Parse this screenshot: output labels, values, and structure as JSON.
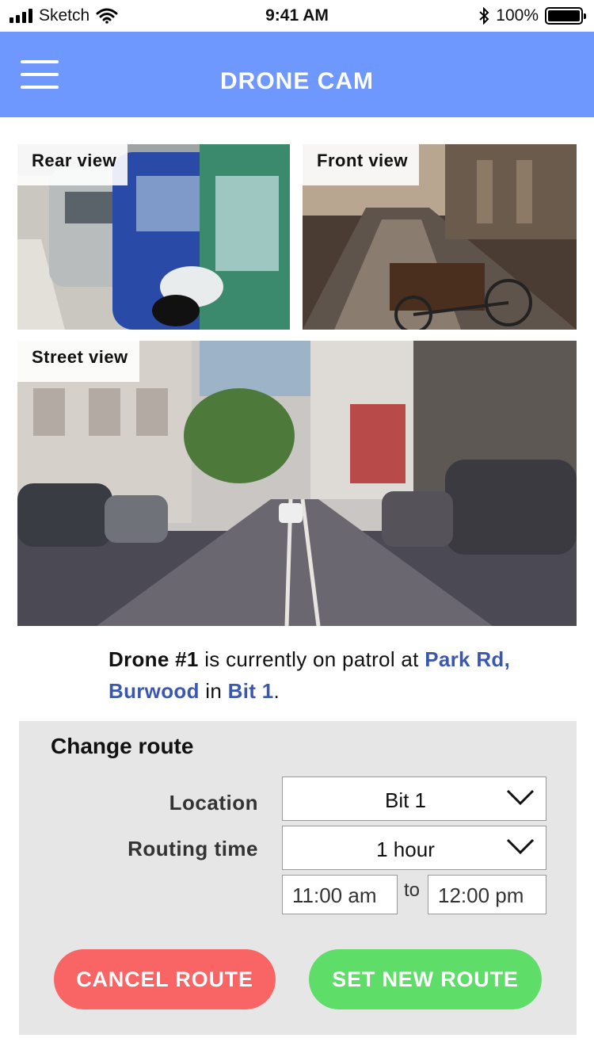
{
  "status_bar": {
    "carrier": "Sketch",
    "time": "9:41 AM",
    "battery": "100%"
  },
  "header": {
    "title": "DRONE CAM"
  },
  "cameras": {
    "rear": {
      "label": "Rear view"
    },
    "front": {
      "label": "Front view"
    },
    "street": {
      "label": "Street view"
    }
  },
  "status": {
    "drone": "Drone #1",
    "text1": " is currently on patrol at ",
    "location": "Park Rd, Burwood",
    "text2": " in ",
    "area": "Bit 1",
    "text3": "."
  },
  "route": {
    "title": "Change route",
    "location_label": "Location",
    "location_value": "Bit 1",
    "routing_label": "Routing time",
    "routing_value": "1 hour",
    "from_time": "11:00 am",
    "to_label": "to",
    "to_time": "12:00 pm",
    "cancel_label": "CANCEL ROUTE",
    "set_label": "SET NEW ROUTE"
  },
  "colors": {
    "header": "#6f98ff",
    "link": "#3a58b0",
    "cancel": "#f96565",
    "set": "#5edd68",
    "panel": "#e6e6e6"
  }
}
